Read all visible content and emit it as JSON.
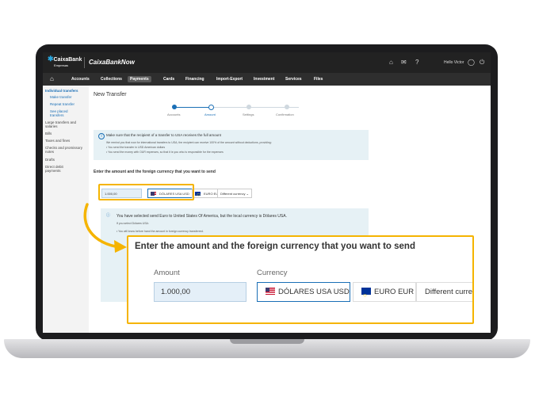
{
  "app": {
    "logo_text": "CaixaBank",
    "logo_sub": "Empresas",
    "brand": "CaixaBankNow",
    "user_greeting": "Hello Victor",
    "icons": [
      "notification-icon",
      "mail-icon",
      "help-icon",
      "user-icon",
      "power-icon"
    ]
  },
  "nav": {
    "items": [
      "Accounts",
      "Collections",
      "Payments",
      "Cards",
      "Financing",
      "Import-Export",
      "Investment",
      "Services",
      "Files"
    ],
    "active": "Payments"
  },
  "sidebar": {
    "items": [
      {
        "label": "Individual transfers",
        "blue": true
      },
      {
        "label": "Make transfer",
        "blue": true
      },
      {
        "label": "Repeat transfer",
        "blue": true
      },
      {
        "label": "See placed transfers",
        "blue": true
      },
      {
        "label": "Large transfers and salaries",
        "blue": false
      },
      {
        "label": "Bills",
        "blue": false
      },
      {
        "label": "Taxes and fines",
        "blue": false
      },
      {
        "label": "Checks and promissory notes",
        "blue": false
      },
      {
        "label": "Drafts",
        "blue": false
      },
      {
        "label": "Direct debit payments",
        "blue": false
      }
    ]
  },
  "page": {
    "title": "New Transfer",
    "steps": [
      "Accounts",
      "Amount",
      "Settings",
      "Confirmation"
    ],
    "current_step": "Amount"
  },
  "notice": {
    "heading": "Make sure that the recipient of a transfer to USA receives the full amount",
    "lines": [
      "We remind you that now for international transfers to USA, the recipient can receive 100% of the amount without deductions, providing:",
      "• You send the transfer in USD American dollars",
      "• You send the money with OUR expenses, so that it is you who is responsible for the expenses"
    ]
  },
  "form": {
    "heading": "Enter the amount and the foreign currency that you want to send",
    "amount_label": "Amount",
    "amount_value": "1.000,00",
    "currency_label": "Currency",
    "currencies": [
      "DÓLARES USA USD",
      "EURO EUR",
      "Different currency"
    ],
    "selected_currency": "DÓLARES USA USD",
    "different_short": "Different curren"
  },
  "currency_info": {
    "heading": "You have selected send Euro to United States Of America, but the local currency is Dólares USA.",
    "sub": "If you select Dólares USA:",
    "lines": [
      "• You will know before hand the amount in foreign currency transferred."
    ]
  }
}
